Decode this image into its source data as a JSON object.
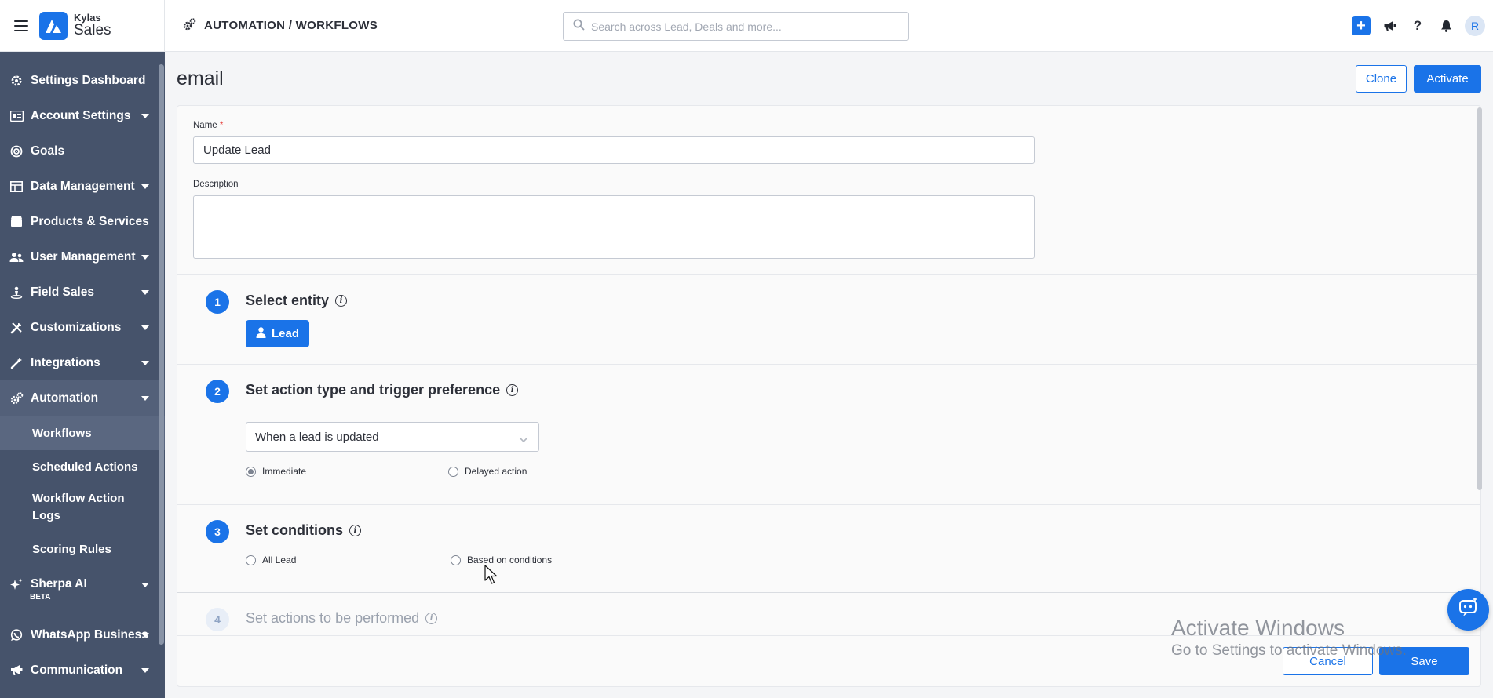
{
  "brand": {
    "small": "Kylas",
    "big": "Sales"
  },
  "topbar": {
    "breadcrumb": "AUTOMATION / WORKFLOWS",
    "search_placeholder": "Search across Lead, Deals and more...",
    "avatar_initial": "R"
  },
  "sidebar": {
    "items": [
      {
        "label": "Settings Dashboard",
        "icon": "gear-icon"
      },
      {
        "label": "Account Settings",
        "icon": "account-icon"
      },
      {
        "label": "Goals",
        "icon": "target-icon"
      },
      {
        "label": "Data Management",
        "icon": "table-icon"
      },
      {
        "label": "Products & Services",
        "icon": "box-icon"
      },
      {
        "label": "User Management",
        "icon": "users-icon"
      },
      {
        "label": "Field Sales",
        "icon": "location-icon"
      },
      {
        "label": "Customizations",
        "icon": "tools-icon"
      },
      {
        "label": "Integrations",
        "icon": "wand-icon"
      },
      {
        "label": "Automation",
        "icon": "gears-icon"
      }
    ],
    "sub_items": [
      "Workflows",
      "Scheduled Actions",
      "Workflow Action Logs",
      "Scoring Rules"
    ],
    "bottom_items": [
      {
        "label": "Sherpa AI",
        "badge": "BETA",
        "icon": "sparkle-icon"
      },
      {
        "label": "WhatsApp Business",
        "icon": "whatsapp-icon"
      },
      {
        "label": "Communication",
        "icon": "megaphone-icon"
      }
    ]
  },
  "page": {
    "title": "email",
    "clone_label": "Clone",
    "activate_label": "Activate"
  },
  "form": {
    "name_label": "Name",
    "required_mark": "*",
    "name_value": "Update Lead",
    "description_label": "Description",
    "description_value": ""
  },
  "steps": [
    {
      "num": "1",
      "title": "Select entity"
    },
    {
      "num": "2",
      "title": "Set action type and trigger preference"
    },
    {
      "num": "3",
      "title": "Set conditions"
    },
    {
      "num": "4",
      "title": "Set actions to be performed"
    }
  ],
  "entity": {
    "label": "Lead"
  },
  "trigger": {
    "selected": "When a lead is updated",
    "immediate_label": "Immediate",
    "delayed_label": "Delayed action",
    "immediate_checked": true
  },
  "conditions": {
    "all_label": "All Lead",
    "based_label": "Based on conditions"
  },
  "footer": {
    "cancel_label": "Cancel",
    "save_label": "Save"
  },
  "watermark": {
    "line1": "Activate Windows",
    "line2": "Go to Settings to activate Windows."
  },
  "colors": {
    "primary": "#1a73e8",
    "sidebar": "#46536b",
    "required": "#e53935"
  }
}
